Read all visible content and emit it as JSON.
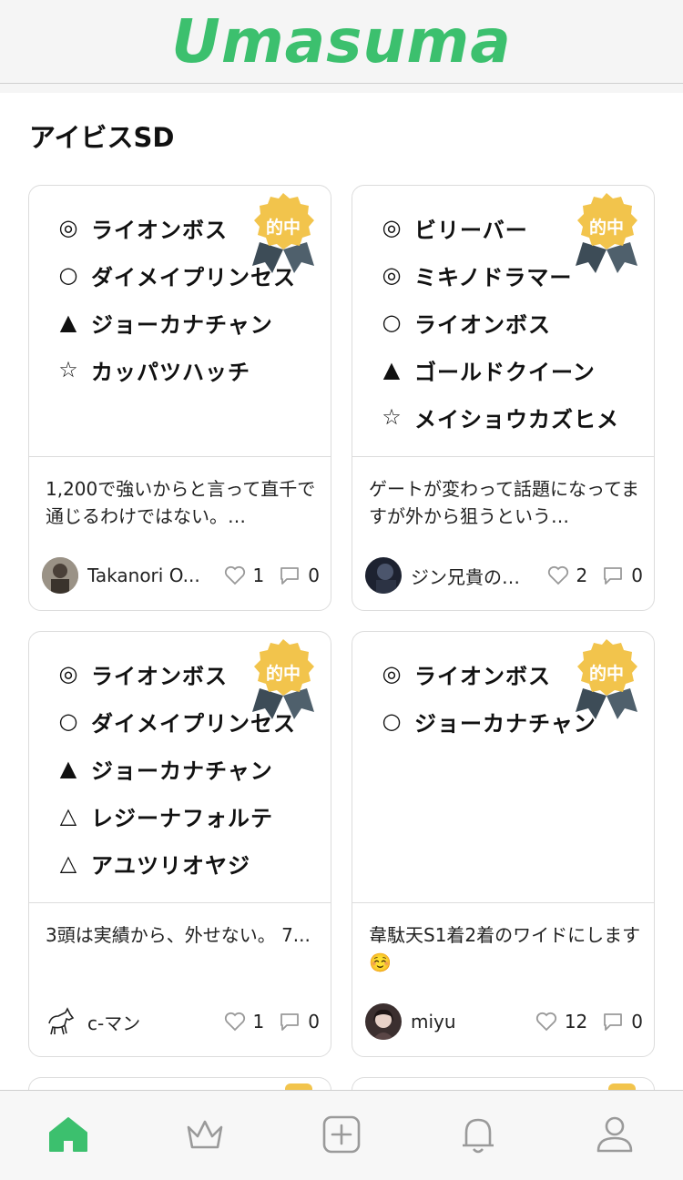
{
  "app": {
    "logo": "Umasuma"
  },
  "page": {
    "title": "アイビスSD"
  },
  "badge_label": "的中",
  "colors": {
    "accent": "#3cc06e",
    "badge_gold": "#f2c44c",
    "badge_ribbon": "#4a5a66"
  },
  "cards": [
    {
      "picks": [
        {
          "mark": "◎",
          "horse": "ライオンボス"
        },
        {
          "mark": "○",
          "horse": "ダイメイプリンセス"
        },
        {
          "mark": "▲",
          "horse": "ジョーカナチャン"
        },
        {
          "mark": "☆",
          "horse": "カッパツハッチ"
        }
      ],
      "comment": "1,200で強いからと言って直千で通じるわけではない。…",
      "user": "Takanori O...",
      "likes": "1",
      "comments": "0"
    },
    {
      "picks": [
        {
          "mark": "◎",
          "horse": "ビリーバー"
        },
        {
          "mark": "◎",
          "horse": "ミキノドラマー"
        },
        {
          "mark": "○",
          "horse": "ライオンボス"
        },
        {
          "mark": "▲",
          "horse": "ゴールドクイーン"
        },
        {
          "mark": "☆",
          "horse": "メイショウカズヒメ"
        }
      ],
      "comment": "ゲートが変わって話題になってますが外から狙うという…",
      "user": "ジン兄貴の…",
      "likes": "2",
      "comments": "0"
    },
    {
      "picks": [
        {
          "mark": "◎",
          "horse": "ライオンボス"
        },
        {
          "mark": "○",
          "horse": "ダイメイプリンセス"
        },
        {
          "mark": "▲",
          "horse": "ジョーカナチャン"
        },
        {
          "mark": "△",
          "horse": "レジーナフォルテ"
        },
        {
          "mark": "△",
          "horse": "アユツリオヤジ"
        }
      ],
      "comment": "3頭は実績から、外せない。 7...",
      "user": "c-マン",
      "likes": "1",
      "comments": "0"
    },
    {
      "picks": [
        {
          "mark": "◎",
          "horse": "ライオンボス"
        },
        {
          "mark": "○",
          "horse": "ジョーカナチャン"
        }
      ],
      "comment": "韋駄天S1着2着のワイドにします ☺️",
      "user": "miyu",
      "likes": "12",
      "comments": "0"
    }
  ],
  "tabbar": [
    {
      "name": "home-icon",
      "active": true
    },
    {
      "name": "crown-icon",
      "active": false
    },
    {
      "name": "plus-square-icon",
      "active": false
    },
    {
      "name": "bell-icon",
      "active": false
    },
    {
      "name": "user-icon",
      "active": false
    }
  ]
}
